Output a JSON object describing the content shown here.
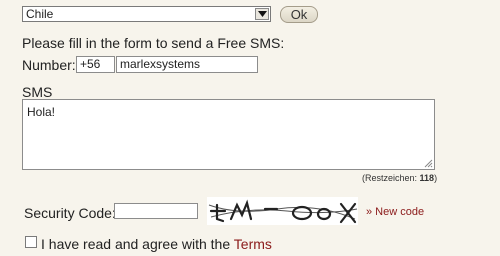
{
  "form": {
    "country": {
      "selected": "Chile"
    },
    "ok_label": "Ok",
    "intro": "Please fill in the form to send a Free SMS:",
    "number_label": "Number:",
    "prefix_value": "+56",
    "number_value": "marlexsystems",
    "sms_label": "SMS",
    "sms_value": "Hola!",
    "remaining_prefix": "(Restzeichen:",
    "remaining_count": "118",
    "remaining_suffix": ")",
    "security_label": "Security Code:",
    "security_value": "",
    "new_code_label": "» New code",
    "agree_text": "I have read and agree with the",
    "terms_label": "Terms"
  },
  "colors": {
    "page_bg": "#f7f4ec",
    "link": "#8b1a1a"
  },
  "icons": {
    "dropdown": "chevron-down-icon",
    "resize": "resize-grip-icon"
  }
}
